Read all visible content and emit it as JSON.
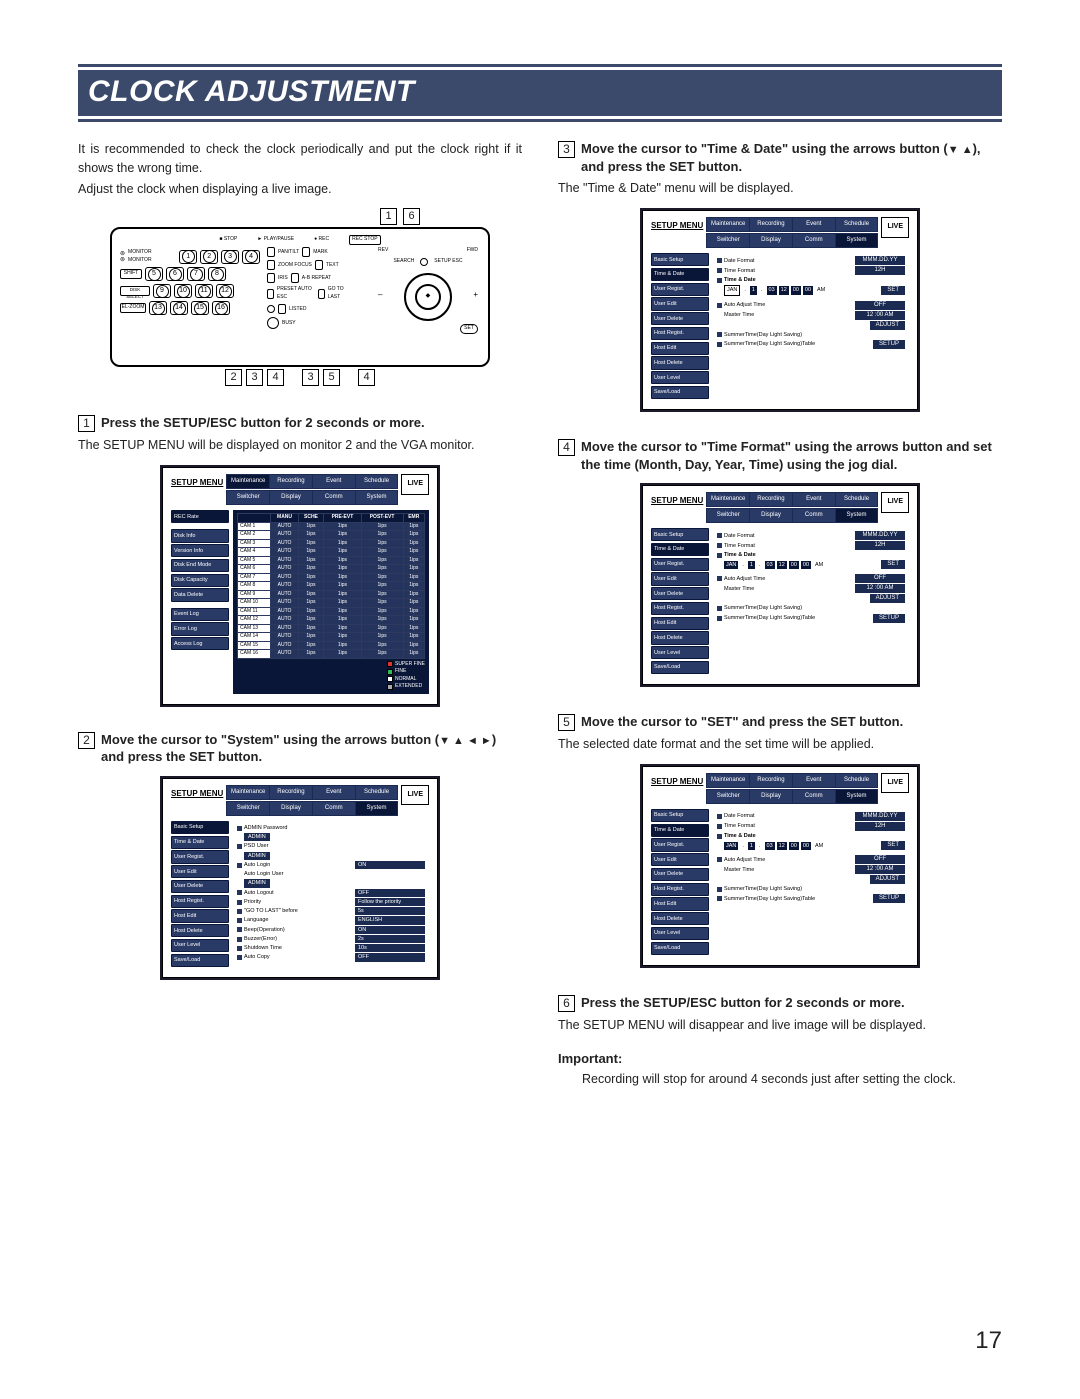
{
  "page_title": "CLOCK ADJUSTMENT",
  "page_number": "17",
  "intro_p1": "It is recommended to check the clock periodically and put the clock right if it shows the wrong time.",
  "intro_p2": "Adjust the clock when displaying a live image.",
  "device_callouts_top": [
    "1",
    "6"
  ],
  "device_callouts_bottom_groups": [
    [
      "2",
      "3",
      "4"
    ],
    [
      "3",
      "5"
    ],
    [
      "4"
    ]
  ],
  "device_panel": {
    "monitor_label": "MONITOR\nMONITOR",
    "btns_row1": [
      "1",
      "2",
      "3",
      "4"
    ],
    "btns_row2": [
      "5",
      "6",
      "7",
      "8"
    ],
    "btns_row3": [
      "9",
      "10",
      "11",
      "12"
    ],
    "btns_row4": [
      "13",
      "14",
      "15",
      "16"
    ],
    "shift": "SHIFT",
    "dnd": "DISK SELECT",
    "zoom": "EL-ZOOM",
    "stop": "STOP",
    "play": "PLAY/PAUSE",
    "rec": "REC",
    "recstop": "REC STOP",
    "rev": "REV",
    "fwd": "FWD",
    "search": "SEARCH",
    "setup": "SETUP\nESC",
    "set": "SET",
    "busy": "BUSY",
    "pan": "PAN/TILT",
    "zoom2": "ZOOM\nFOCUS",
    "iris": "IRIS",
    "preset": "PRESET\nAUTO\nESC",
    "mark": "MARK",
    "text": "TEXT",
    "ab": "A-B\nREPEAT",
    "goto": "GO TO\nLAST",
    "listed": "LISTED",
    "num_circles": [
      "1",
      "2",
      "3",
      "4",
      "5",
      "6",
      "7",
      "8",
      "9",
      "10",
      "11",
      "12",
      "13",
      "14",
      "15",
      "16"
    ]
  },
  "steps": {
    "s1": {
      "num": "1",
      "title": "Press the SETUP/ESC button for 2 seconds or more.",
      "desc": "The SETUP MENU will be displayed on monitor 2 and the VGA monitor."
    },
    "s2": {
      "num": "2",
      "title_a": "Move the cursor to \"System\" using the arrows button (",
      "title_b": ") and press the SET button."
    },
    "s3": {
      "num": "3",
      "title_a": "Move the cursor to \"Time & Date\" using the arrows button (",
      "title_b": "), and press the SET button.",
      "desc": "The \"Time & Date\" menu will be displayed."
    },
    "s4": {
      "num": "4",
      "title": "Move the cursor to \"Time Format\" using the arrows button and set the time (Month, Day, Year, Time) using the jog dial."
    },
    "s5": {
      "num": "5",
      "title": "Move the cursor to \"SET\" and press the SET button.",
      "desc": "The selected date format and the set time will be applied."
    },
    "s6": {
      "num": "6",
      "title": "Press the SETUP/ESC button for 2 seconds or more.",
      "desc": "The SETUP MENU will disappear and live image will be displayed."
    }
  },
  "important": {
    "head": "Important:",
    "body": "Recording will stop for around 4 seconds just after setting the clock."
  },
  "menu_common": {
    "title": "SETUP MENU",
    "tabs_row1": [
      "Maintenance",
      "Recording",
      "Event",
      "Schedule"
    ],
    "tabs_row2": [
      "Switcher",
      "Display",
      "Comm",
      "System"
    ],
    "live": "LIVE"
  },
  "menu1": {
    "side": [
      "REC Rate",
      "",
      "Disk Info",
      "Version Info",
      "Disk End Mode",
      "Disk Capacity",
      "Data Delete",
      "",
      "Event Log",
      "Error Log",
      "Access Log"
    ],
    "headers": [
      "",
      "MANU",
      "SCHE",
      "PRE-EVT",
      "POST-EVT",
      "EMR"
    ],
    "cams": [
      "CAM 1",
      "CAM 2",
      "CAM 3",
      "CAM 4",
      "CAM 5",
      "CAM 6",
      "CAM 7",
      "CAM 8",
      "CAM 9",
      "CAM 10",
      "CAM 11",
      "CAM 12",
      "CAM 13",
      "CAM 14",
      "CAM 15",
      "CAM 16"
    ],
    "cell_mode": "AUTO",
    "cell_rate": "1ips",
    "legend": [
      "SUPER FINE",
      "FINE",
      "NORMAL",
      "EXTENDED"
    ]
  },
  "menu2": {
    "side": [
      "Basic Setup",
      "Time & Date",
      "User Regist.",
      "User Edit",
      "User Delete",
      "Host Regist.",
      "Host Edit",
      "Host Delete",
      "User Level",
      "Save/Load"
    ],
    "items": [
      {
        "label": "ADMIN Password",
        "val": ""
      },
      {
        "btn": "ADMIN"
      },
      {
        "label": "PSD User",
        "val": ""
      },
      {
        "btn": "ADMIN"
      },
      {
        "label": "Auto Login",
        "val": "ON"
      },
      {
        "plain": "Auto Login User"
      },
      {
        "btn": "ADMIN"
      },
      {
        "label": "Auto Logout",
        "val": "OFF"
      },
      {
        "label": "Priority",
        "val": "Follow the priority"
      },
      {
        "label": "\"GO TO LAST\" before",
        "val": "5s"
      },
      {
        "label": "Language",
        "val": "ENGLISH"
      },
      {
        "label": "Beep(Operation)",
        "val": "ON"
      },
      {
        "label": "Buzzer(Error)",
        "val": "2s"
      },
      {
        "label": "Shutdown Time",
        "val": "10s"
      },
      {
        "label": "Auto Copy",
        "val": "OFF"
      }
    ]
  },
  "menu_time": {
    "side": [
      "Basic Setup",
      "Time & Date",
      "User Regist.",
      "User Edit",
      "User Delete",
      "Host Regist.",
      "Host Edit",
      "Host Delete",
      "User Level",
      "Save/Load"
    ],
    "date_format_label": "Date Format",
    "date_format_val": "MMM.DD.YY",
    "time_format_label": "Time Format",
    "time_format_val": "12H",
    "time_date_label": "Time & Date",
    "date_chips_a": [
      "JAN",
      "1"
    ],
    "date_chips_b": [
      "03",
      "12",
      "00",
      "00"
    ],
    "am": "AM",
    "set_btn": "SET",
    "auto_label": "Auto Adjust Time",
    "auto_val": "OFF",
    "master_label": "Master Time",
    "master_val": "12 :00  AM",
    "adjust": "ADJUST",
    "summer1": "SummerTime(Day Light Saving)",
    "summer2": "SummerTime(Day Light Saving)Table",
    "setup_btn": "SETUP"
  },
  "arrows4": "▼  ▲  ◄  ►",
  "arrows2": "▼  ▲"
}
